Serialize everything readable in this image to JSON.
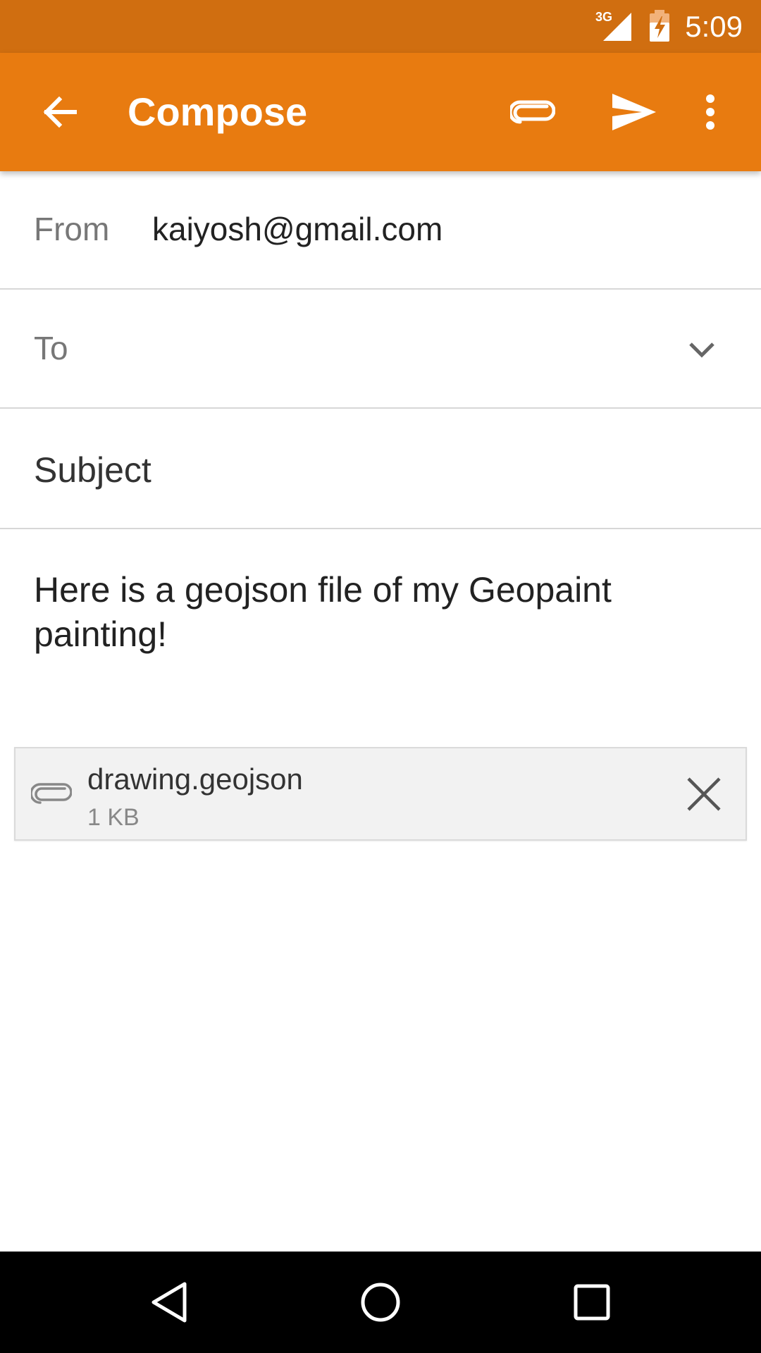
{
  "status_bar": {
    "network": "3G",
    "time": "5:09",
    "icons": [
      "signal-icon",
      "battery-charging-icon"
    ]
  },
  "app_bar": {
    "title": "Compose",
    "icons": [
      "back-arrow-icon",
      "paperclip-icon",
      "send-icon",
      "more-vert-icon"
    ]
  },
  "from": {
    "label": "From",
    "value": "kaiyosh@gmail.com"
  },
  "to": {
    "label": "To",
    "value": "",
    "icon": "chevron-down-icon"
  },
  "subject": {
    "placeholder": "Subject",
    "value": ""
  },
  "body": {
    "text": "Here is a geojson file of my Geopaint painting!"
  },
  "attachment": {
    "file_name": "drawing.geojson",
    "file_size": "1 KB",
    "icons": [
      "paperclip-icon",
      "close-icon"
    ]
  },
  "nav_bar": {
    "icons": [
      "nav-back-icon",
      "nav-home-icon",
      "nav-recents-icon"
    ]
  },
  "colors": {
    "status_bar": "#D06E10",
    "app_bar": "#E87B10",
    "nav_bar": "#000000"
  }
}
